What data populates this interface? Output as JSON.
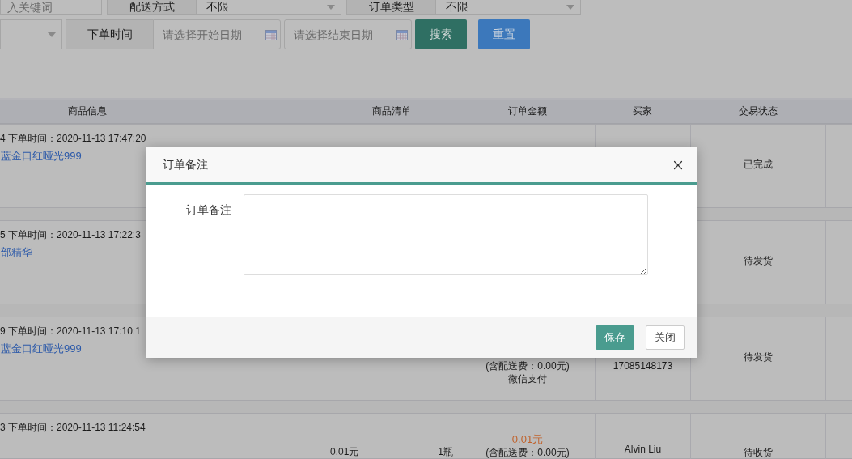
{
  "filters": {
    "rows": [
      [
        {
          "kind": "text_input",
          "placeholder": "入关键词"
        },
        {
          "kind": "select",
          "label": "配送方式",
          "value": "不限"
        },
        {
          "kind": "select",
          "label": "订单类型",
          "value": "不限"
        }
      ],
      [
        {
          "kind": "select"
        },
        {
          "kind": "date_range",
          "label": "下单时间",
          "start_placeholder": "请选择开始日期",
          "end_placeholder": "请选择结束日期"
        }
      ]
    ],
    "buttons": [
      {
        "kind": "primary",
        "label": "搜索"
      },
      {
        "kind": "secondary",
        "label": "重置"
      }
    ]
  },
  "table": {
    "columns": [
      "商品信息",
      "商品清单",
      "订单金额",
      "买家",
      "交易状态"
    ],
    "rows": [
      {
        "order_info": "4 下单时间：2020-11-13 17:47:20",
        "product": "蓝金口红哑光999",
        "status": "已完成"
      },
      {
        "order_info": "5 下单时间：2020-11-13 17:22:3",
        "product": "部精华",
        "status": "待发货"
      },
      {
        "order_info": "9 下单时间：2020-11-13 17:10:1",
        "product": "蓝金口红哑光999",
        "shipping_note": "(含配送费：0.00元)",
        "payment": "微信支付",
        "buyer_phone": "17085148173",
        "status": "待发货"
      },
      {
        "order_info": "3 下单时间：2020-11-13 11:24:54",
        "item_price": "0.01元",
        "item_quantity": "1瓶",
        "amount": "0.01元",
        "shipping_note": "(含配送费：0.00元)",
        "buyer_name": "Alvin Liu",
        "status": "待收货"
      }
    ]
  },
  "dialog": {
    "title": "订单备注",
    "field_label": "订单备注",
    "buttons": [
      {
        "kind": "primary",
        "label": "保存"
      },
      {
        "kind": "default",
        "label": "关闭"
      }
    ]
  }
}
